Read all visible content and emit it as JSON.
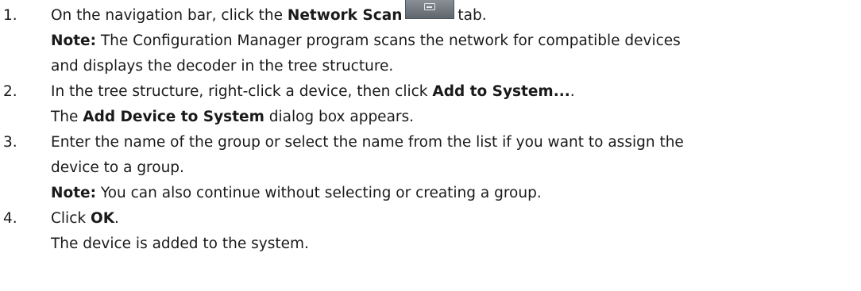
{
  "steps": [
    {
      "number": "1.",
      "line1_a": "On the navigation bar, click the ",
      "line1_bold": "Network Scan",
      "line1_c": "tab.",
      "icon": "network-scan-tab-icon",
      "note_label": "Note:",
      "note_line1": " The Configuration Manager program scans the network for compatible devices",
      "note_line2": "and displays the decoder in the tree structure."
    },
    {
      "number": "2.",
      "line1_a": "In the tree structure, right-click a device, then click ",
      "line1_bold": "Add to System...",
      "line1_c": ".",
      "line2_a": "The ",
      "line2_bold": "Add Device to System",
      "line2_c": " dialog box appears."
    },
    {
      "number": "3.",
      "line1": "Enter the name of the group or select the name from the list if you want to assign the",
      "line2": "device to a group.",
      "note_label": "Note:",
      "note_text": " You can also continue without selecting or creating a group."
    },
    {
      "number": "4.",
      "line1_a": "Click ",
      "line1_bold": "OK",
      "line1_c": ".",
      "line2": "The device is added to the system."
    }
  ]
}
